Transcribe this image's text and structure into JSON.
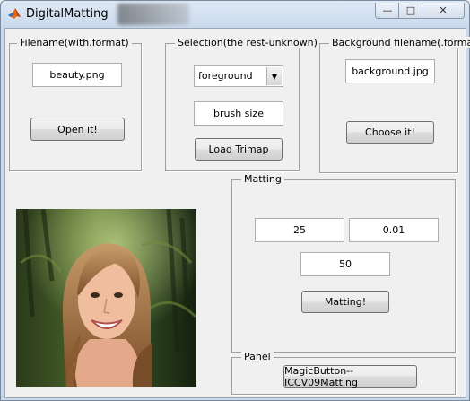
{
  "window": {
    "title": "DigitalMatting",
    "minimize_glyph": "—",
    "maximize_glyph": "□",
    "close_glyph": "✕"
  },
  "filename_panel": {
    "title": "Filename(with.format)",
    "value": "beauty.png",
    "open_label": "Open it!"
  },
  "selection_panel": {
    "title": "Selection(the rest-unknown)",
    "dropdown_selected": "foreground",
    "brush_size": "brush size",
    "load_trimap_label": "Load Trimap"
  },
  "background_panel": {
    "title": "Background filename(.format)",
    "value": "background.jpg",
    "choose_label": "Choose it!"
  },
  "matting_panel": {
    "title": "Matting",
    "param1": "25",
    "param2": "0.01",
    "param3": "50",
    "matting_label": "Matting!"
  },
  "bottom_panel": {
    "title": "Panel",
    "magic_label": "MagicButton--ICCV09Matting"
  },
  "icons": {
    "app": "matlab-logo-icon",
    "dropdown": "chevron-down-icon"
  }
}
